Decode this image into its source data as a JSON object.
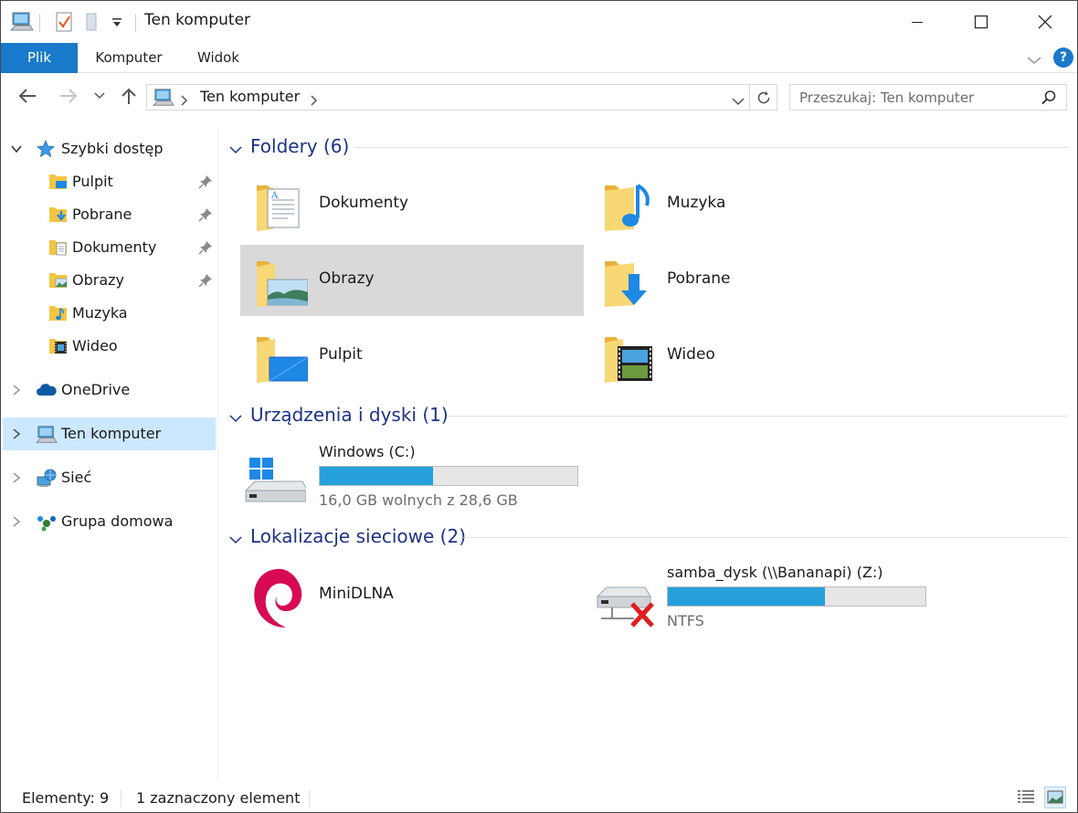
{
  "window": {
    "title": "Ten komputer",
    "controls": {
      "minimize": "minimize",
      "maximize": "maximize",
      "close": "close"
    }
  },
  "ribbon": {
    "tabs": [
      {
        "id": "plik",
        "label": "Plik"
      },
      {
        "id": "komputer",
        "label": "Komputer"
      },
      {
        "id": "widok",
        "label": "Widok"
      }
    ],
    "help_label": "?"
  },
  "address": {
    "path": "Ten komputer",
    "search_placeholder": "Przeszukaj: Ten komputer"
  },
  "sidebar": {
    "quick_access": {
      "label": "Szybki dostęp",
      "items": [
        {
          "label": "Pulpit",
          "icon": "desktop-folder-icon",
          "pinned": true
        },
        {
          "label": "Pobrane",
          "icon": "downloads-folder-icon",
          "pinned": true
        },
        {
          "label": "Dokumenty",
          "icon": "documents-folder-icon",
          "pinned": true
        },
        {
          "label": "Obrazy",
          "icon": "pictures-folder-icon",
          "pinned": true
        },
        {
          "label": "Muzyka",
          "icon": "music-folder-icon",
          "pinned": false
        },
        {
          "label": "Wideo",
          "icon": "videos-folder-icon",
          "pinned": false
        }
      ]
    },
    "roots": [
      {
        "label": "OneDrive",
        "icon": "onedrive-cloud-icon",
        "selected": false
      },
      {
        "label": "Ten komputer",
        "icon": "this-pc-icon",
        "selected": true
      },
      {
        "label": "Sieć",
        "icon": "network-icon",
        "selected": false
      },
      {
        "label": "Grupa domowa",
        "icon": "homegroup-icon",
        "selected": false
      }
    ]
  },
  "content": {
    "folders": {
      "title": "Foldery (6)",
      "items": [
        {
          "label": "Dokumenty",
          "icon": "documents-folder-icon",
          "selected": false
        },
        {
          "label": "Muzyka",
          "icon": "music-folder-icon",
          "selected": false
        },
        {
          "label": "Obrazy",
          "icon": "pictures-folder-icon",
          "selected": true
        },
        {
          "label": "Pobrane",
          "icon": "downloads-folder-icon",
          "selected": false
        },
        {
          "label": "Pulpit",
          "icon": "desktop-folder-icon",
          "selected": false
        },
        {
          "label": "Wideo",
          "icon": "videos-folder-icon",
          "selected": false
        }
      ]
    },
    "devices": {
      "title": "Urządzenia i dyski (1)",
      "items": [
        {
          "label": "Windows (C:)",
          "subtitle": "16,0 GB wolnych z 28,6 GB",
          "used_fraction": 0.44,
          "icon": "windows-drive-icon"
        }
      ]
    },
    "network": {
      "title": "Lokalizacje sieciowe (2)",
      "items": [
        {
          "label": "MiniDLNA",
          "icon": "debian-swirl-icon"
        },
        {
          "label": "samba_dysk (\\\\Bananapi) (Z:)",
          "subtitle": "NTFS",
          "used_fraction": 0.61,
          "icon": "disconnected-network-drive-icon"
        }
      ]
    }
  },
  "status": {
    "count": "Elementy: 9",
    "selection": "1 zaznaczony element"
  },
  "colors": {
    "accent": "#1979ca",
    "group_title": "#1e3287",
    "drive_bar": "#26a0da",
    "selection_nav": "#cce8ff",
    "selection_tile": "#d9d9d9"
  }
}
